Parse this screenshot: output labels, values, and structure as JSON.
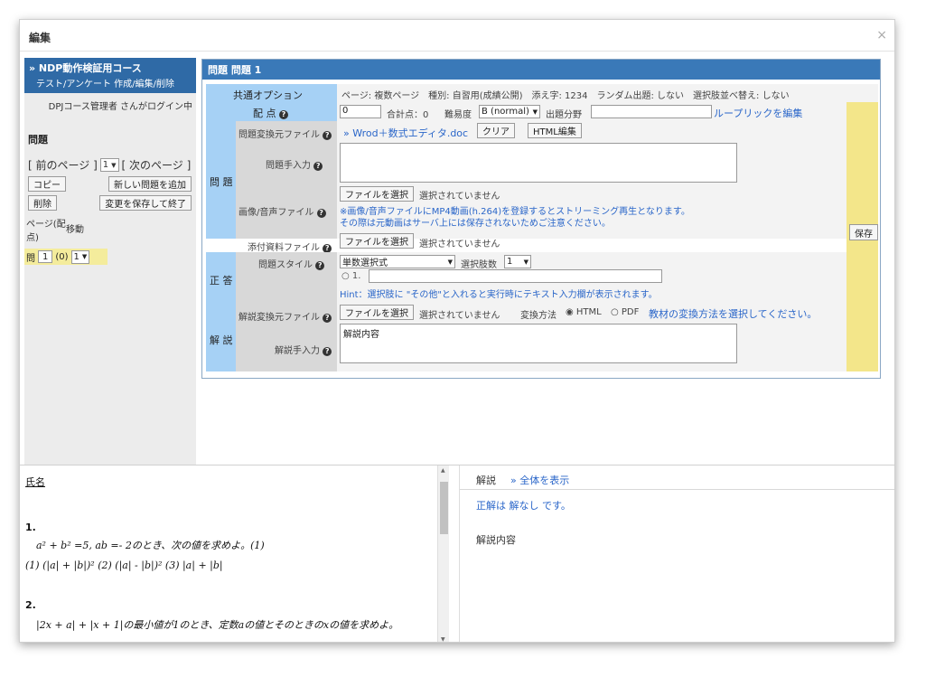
{
  "dialog": {
    "title": "編集",
    "close": "×"
  },
  "left": {
    "course": "» NDP動作検証用コース",
    "course_links": "テスト/アンケート 作成/編集/削除",
    "login": "DPJコース管理者 さんがログイン中",
    "section_title": "問題",
    "pager_prev": "[ 前のページ ]",
    "pager_page": "1",
    "pager_next": "[ 次のページ ]",
    "btn_copy": "コピー",
    "btn_add": "新しい問題を追加",
    "btn_delete": "削除",
    "btn_save_exit": "変更を保存して終了",
    "col_page": "ページ(配点)",
    "col_move": "移動",
    "q_label": "問",
    "q_num": "1",
    "q_points": "(0)",
    "q_move": "1"
  },
  "main": {
    "title": "問題 問題 1",
    "common_label": "共通オプション",
    "common_values": "ページ: 複数ページ　種別: 自習用(成績公開)　添え字: 1234　ランダム出題: しない　選択肢並べ替え: しない",
    "score_label": "配 点",
    "score_value": "0",
    "total_label": "合計点：0",
    "difficulty_label": "難易度",
    "difficulty_value": "B (normal)",
    "field_label": "出題分野",
    "rubric_link": "ループリックを編集",
    "save_button": "保存",
    "question_group": "問 題",
    "convert_src_label": "問題変換元ファイル",
    "convert_src_file": "» Wrod＋数式エディタ.doc",
    "clear_button": "クリア",
    "html_edit_button": "HTML編集",
    "question_input_label": "問題手入力",
    "media_label": "画像/音声ファイル",
    "file_choose": "ファイルを選択",
    "no_file": "選択されていません",
    "media_note1": "※画像/音声ファイルにMP4動画(h.264)を登録するとストリーミング再生となります。",
    "media_note2": "その際は元動画はサーバ上には保存されないためご注意ください。",
    "attach_label": "添付資料ファイル",
    "answer_group": "正 答",
    "style_label": "問題スタイル",
    "style_value": "単数選択式",
    "choice_count_label": "選択肢数",
    "choice_count_value": "1",
    "choice_1": "1.",
    "hint": "Hint：選択肢に \"その他\"と入れると実行時にテキスト入力欄が表示されます。",
    "explain_group": "解 説",
    "explain_src_label": "解説変換元ファイル",
    "convert_method_label": "変換方法",
    "method_html": "HTML",
    "method_pdf": "PDF",
    "method_link": "教材の変換方法を選択してください。",
    "explain_input_label": "解説手入力",
    "explain_input_value": "解説内容"
  },
  "preview": {
    "name_label": "氏名",
    "q1_num": "1.",
    "q1_text": "a² + b² =5, ab =- 2のとき、次の値を求めよ。(1)",
    "q1_parts": "(1) (|a| + |b|)²  (2) (|a| - |b|)²  (3) |a| + |b|",
    "q2_num": "2.",
    "q2_text": "|2x + a| + |x + 1|の最小値が1のとき、定数aの値とそのときのxの値を求めよ。"
  },
  "answer_panel": {
    "tab": "解説",
    "show_all": "» 全体を表示",
    "correct": "正解は 解なし です。",
    "explanation": "解説内容"
  }
}
